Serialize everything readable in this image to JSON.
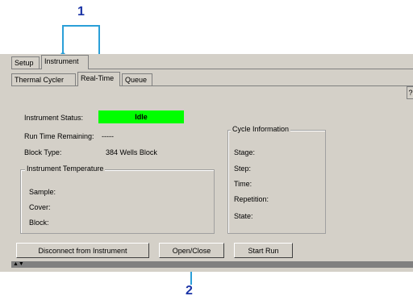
{
  "callouts": {
    "one": "1",
    "two": "2"
  },
  "top_tabs": [
    {
      "label": "Setup"
    },
    {
      "label": "Instrument"
    }
  ],
  "sub_tabs": [
    {
      "label": "Thermal Cycler"
    },
    {
      "label": "Real-Time"
    },
    {
      "label": "Queue"
    }
  ],
  "instrument_status": {
    "label": "Instrument Status:",
    "value": "Idle",
    "color": "#00ff00"
  },
  "run_time": {
    "label": "Run Time Remaining:",
    "value": "-----"
  },
  "block_type": {
    "label": "Block Type:",
    "value": "384 Wells Block"
  },
  "instrument_temperature": {
    "title": "Instrument Temperature",
    "fields": [
      "Sample:",
      "Cover:",
      "Block:"
    ]
  },
  "cycle_information": {
    "title": "Cycle Information",
    "fields": [
      "Stage:",
      "Step:",
      "Time:",
      "Repetition:",
      "State:"
    ]
  },
  "buttons": {
    "disconnect": "Disconnect from Instrument",
    "open_close": "Open/Close",
    "start_run": "Start Run"
  },
  "help_glyph": "?",
  "arrows": "▲▼"
}
